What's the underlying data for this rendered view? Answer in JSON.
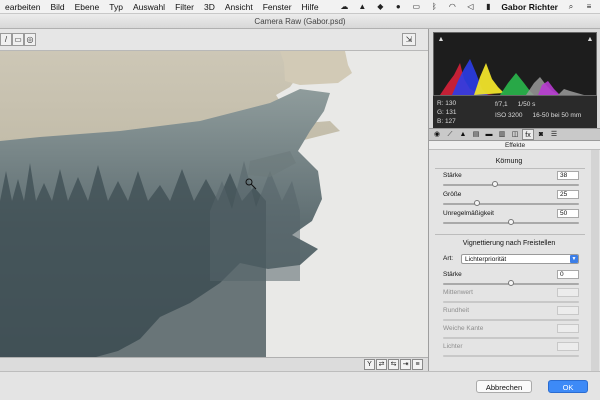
{
  "menubar": {
    "items": [
      "earbeiten",
      "Bild",
      "Ebene",
      "Typ",
      "Auswahl",
      "Filter",
      "3D",
      "Ansicht",
      "Fenster",
      "Hilfe"
    ],
    "user": "Gabor Richter"
  },
  "window": {
    "title": "Camera Raw (Gabor.psd)"
  },
  "info": {
    "r": "R:  130",
    "g": "G:  131",
    "b": "B:  127",
    "aperture": "f/7,1",
    "shutter": "1/50 s",
    "iso": "ISO 3200",
    "lens": "16-50 bei 50 mm"
  },
  "panel": {
    "header": "Effekte",
    "grain": {
      "title": "Körnung",
      "rows": [
        {
          "label": "Stärke",
          "value": "38",
          "fraction": 0.38
        },
        {
          "label": "Größe",
          "value": "25",
          "fraction": 0.25
        },
        {
          "label": "Unregelmäßigkeit",
          "value": "50",
          "fraction": 0.5
        }
      ]
    },
    "vignette": {
      "title": "Vignettierung nach Freistellen",
      "type_label": "Art:",
      "type_value": "Lichterpriorität",
      "rows": [
        {
          "label": "Stärke",
          "value": "0",
          "fraction": 0.5,
          "enabled": true
        },
        {
          "label": "Mittenwert",
          "value": "",
          "enabled": false
        },
        {
          "label": "Rundheit",
          "value": "",
          "enabled": false
        },
        {
          "label": "Weiche Kante",
          "value": "",
          "enabled": false
        },
        {
          "label": "Lichter",
          "value": "",
          "enabled": false
        }
      ]
    }
  },
  "footer": {
    "cancel": "Abbrechen",
    "ok": "OK"
  },
  "colors": {
    "accent": "#3d8af7",
    "panel_bg": "#e4e4e4",
    "canvas_bg": "#e9e9e7"
  }
}
